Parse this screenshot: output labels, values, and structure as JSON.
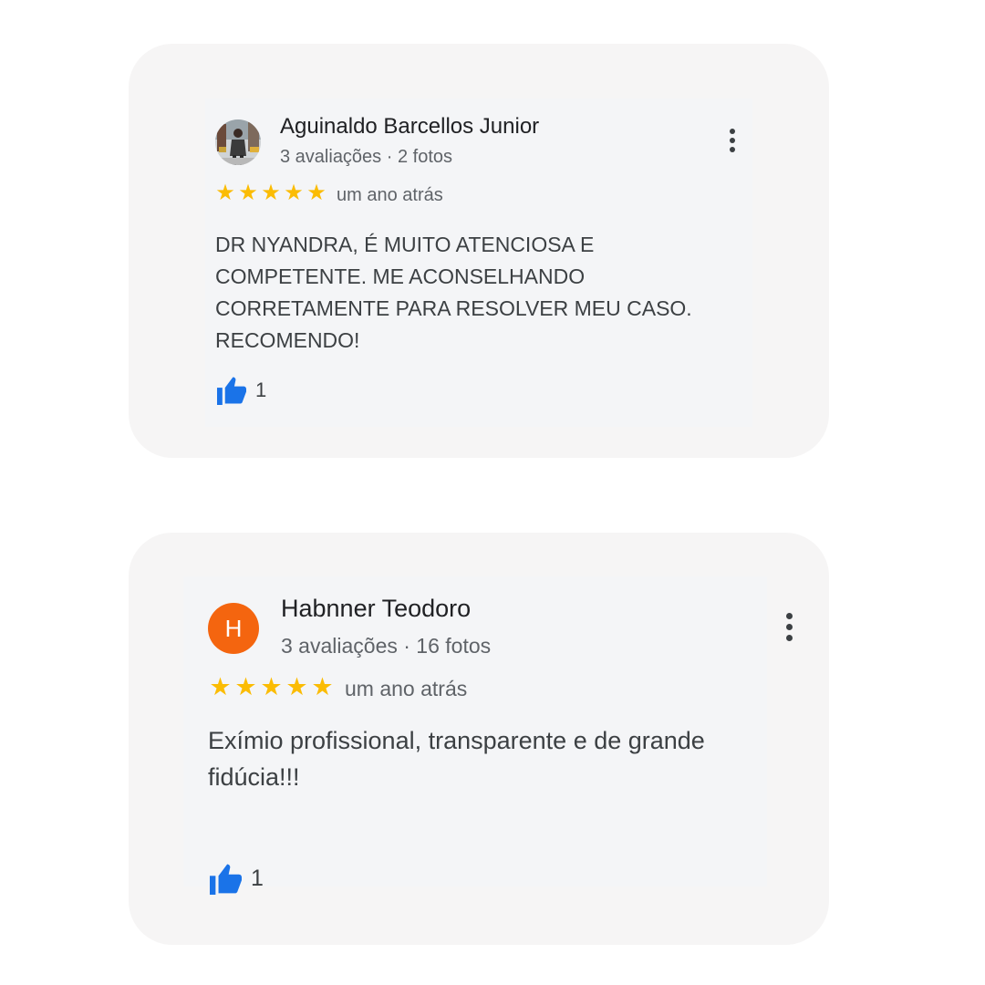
{
  "reviews": [
    {
      "reviewer_name": "Aguinaldo Barcellos Junior",
      "reviewer_meta": "3 avaliações · 2 fotos",
      "rating": 5,
      "stars": [
        "★",
        "★",
        "★",
        "★",
        "★"
      ],
      "date": "um ano atrás",
      "text": "DR NYANDRA, É MUITO ATENCIOSA E COMPETENTE. ME ACONSELHANDO CORRETAMENTE PARA RESOLVER MEU CASO. RECOMENDO!",
      "likes": "1",
      "avatar_type": "photo"
    },
    {
      "reviewer_name": "Habnner Teodoro",
      "reviewer_meta": "3 avaliações · 16 fotos",
      "avatar_letter": "H",
      "rating": 5,
      "stars": [
        "★",
        "★",
        "★",
        "★",
        "★"
      ],
      "date": "um ano atrás",
      "text": "Exímio profissional, transparente e de grande fidúcia!!!",
      "likes": "1",
      "avatar_type": "letter"
    }
  ],
  "colors": {
    "star": "#fbbc04",
    "like_icon": "#1a73e8",
    "avatar_letter_bg": "#f4650f",
    "card_outer_bg": "#f6f5f5",
    "card_inner_bg": "#f4f5f7"
  },
  "icons": {
    "more": "more-vert-icon",
    "like": "thumb-up-icon",
    "star": "star-icon"
  }
}
